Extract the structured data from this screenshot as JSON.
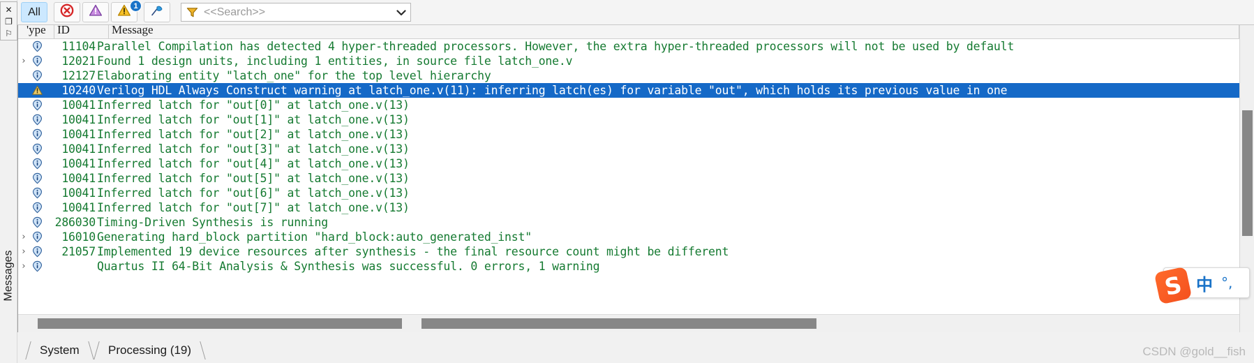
{
  "panel": {
    "title": "Messages",
    "window_buttons": [
      {
        "name": "close",
        "glyph": "✕"
      },
      {
        "name": "restore",
        "glyph": "❐"
      },
      {
        "name": "pin",
        "glyph": "⚐"
      }
    ]
  },
  "toolbar": {
    "all_label": "All",
    "filters": [
      {
        "name": "error-filter",
        "icon": "error-circle-icon",
        "badge": ""
      },
      {
        "name": "critical-warning-filter",
        "icon": "critical-warning-triangle-icon",
        "badge": ""
      },
      {
        "name": "warning-filter",
        "icon": "warning-triangle-icon",
        "badge": "1"
      },
      {
        "name": "info-flag-filter",
        "icon": "blue-flag-icon",
        "badge": ""
      }
    ],
    "search": {
      "placeholder": "<<Search>>",
      "funnel_icon": "funnel-filter-icon",
      "dropdown_icon": "chevron-down-icon"
    }
  },
  "grid": {
    "columns": [
      "Type",
      "ID",
      "Message"
    ],
    "column_type_clipped": "'ype",
    "rows": [
      {
        "expand": false,
        "icon": "info",
        "id": "11104",
        "text": "Parallel Compilation has detected 4 hyper-threaded processors. However, the extra hyper-threaded processors will not be used by default",
        "selected": false
      },
      {
        "expand": true,
        "icon": "info",
        "id": "12021",
        "text": "Found 1 design units, including 1 entities, in source file latch_one.v",
        "selected": false
      },
      {
        "expand": false,
        "icon": "info",
        "id": "12127",
        "text": "Elaborating entity \"latch_one\" for the top level hierarchy",
        "selected": false
      },
      {
        "expand": false,
        "icon": "warning",
        "id": "10240",
        "text": "Verilog HDL Always Construct warning at latch_one.v(11): inferring latch(es) for variable \"out\", which holds its previous value in one",
        "selected": true
      },
      {
        "expand": false,
        "icon": "info",
        "id": "10041",
        "text": "Inferred latch for \"out[0]\" at latch_one.v(13)",
        "selected": false
      },
      {
        "expand": false,
        "icon": "info",
        "id": "10041",
        "text": "Inferred latch for \"out[1]\" at latch_one.v(13)",
        "selected": false
      },
      {
        "expand": false,
        "icon": "info",
        "id": "10041",
        "text": "Inferred latch for \"out[2]\" at latch_one.v(13)",
        "selected": false
      },
      {
        "expand": false,
        "icon": "info",
        "id": "10041",
        "text": "Inferred latch for \"out[3]\" at latch_one.v(13)",
        "selected": false
      },
      {
        "expand": false,
        "icon": "info",
        "id": "10041",
        "text": "Inferred latch for \"out[4]\" at latch_one.v(13)",
        "selected": false
      },
      {
        "expand": false,
        "icon": "info",
        "id": "10041",
        "text": "Inferred latch for \"out[5]\" at latch_one.v(13)",
        "selected": false
      },
      {
        "expand": false,
        "icon": "info",
        "id": "10041",
        "text": "Inferred latch for \"out[6]\" at latch_one.v(13)",
        "selected": false
      },
      {
        "expand": false,
        "icon": "info",
        "id": "10041",
        "text": "Inferred latch for \"out[7]\" at latch_one.v(13)",
        "selected": false
      },
      {
        "expand": false,
        "icon": "info",
        "id": "286030",
        "text": "Timing-Driven Synthesis is running",
        "selected": false
      },
      {
        "expand": true,
        "icon": "info",
        "id": "16010",
        "text": "Generating hard_block partition \"hard_block:auto_generated_inst\"",
        "selected": false
      },
      {
        "expand": true,
        "icon": "info",
        "id": "21057",
        "text": "Implemented 19 device resources after synthesis - the final resource count might be different",
        "selected": false
      },
      {
        "expand": true,
        "icon": "info",
        "id": "",
        "text": "Quartus II 64-Bit Analysis & Synthesis was successful. 0 errors, 1 warning",
        "selected": false
      }
    ]
  },
  "tabs": [
    {
      "label": "System",
      "selected": false
    },
    {
      "label": "Processing (19)",
      "selected": true
    }
  ],
  "ime": {
    "logo_letter": "S",
    "mode_label": "中",
    "punct_label": "°,"
  },
  "watermark": "CSDN @gold__fish",
  "colors": {
    "message_green": "#157a31",
    "selection_blue": "#1569c7",
    "accent_blue": "#1a73c8",
    "ime_orange": "#f4511e"
  }
}
